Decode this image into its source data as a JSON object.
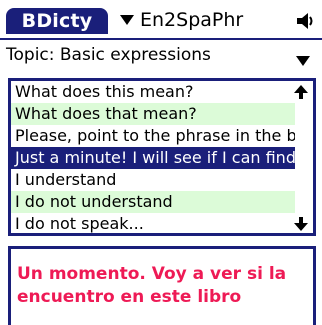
{
  "header": {
    "app_title": "BDicty",
    "dictionary": "En2SpaPhr",
    "speaker_icon": "speaker-icon"
  },
  "topic": {
    "label": "Topic: Basic expressions"
  },
  "list": {
    "items": [
      "What does this mean?",
      "What does that mean?",
      "Please, point to the phrase in the bo",
      "Just a minute! I will see if I can find it",
      "I understand",
      "I do not understand",
      "I do not speak..."
    ],
    "selected_index": 3
  },
  "translation": {
    "text": "Un momento. Voy a ver si la encuentro en este libro"
  },
  "colors": {
    "accent": "#1a1f7a",
    "row_alt": "#dcfbd8",
    "translation": "#ee1a55"
  }
}
